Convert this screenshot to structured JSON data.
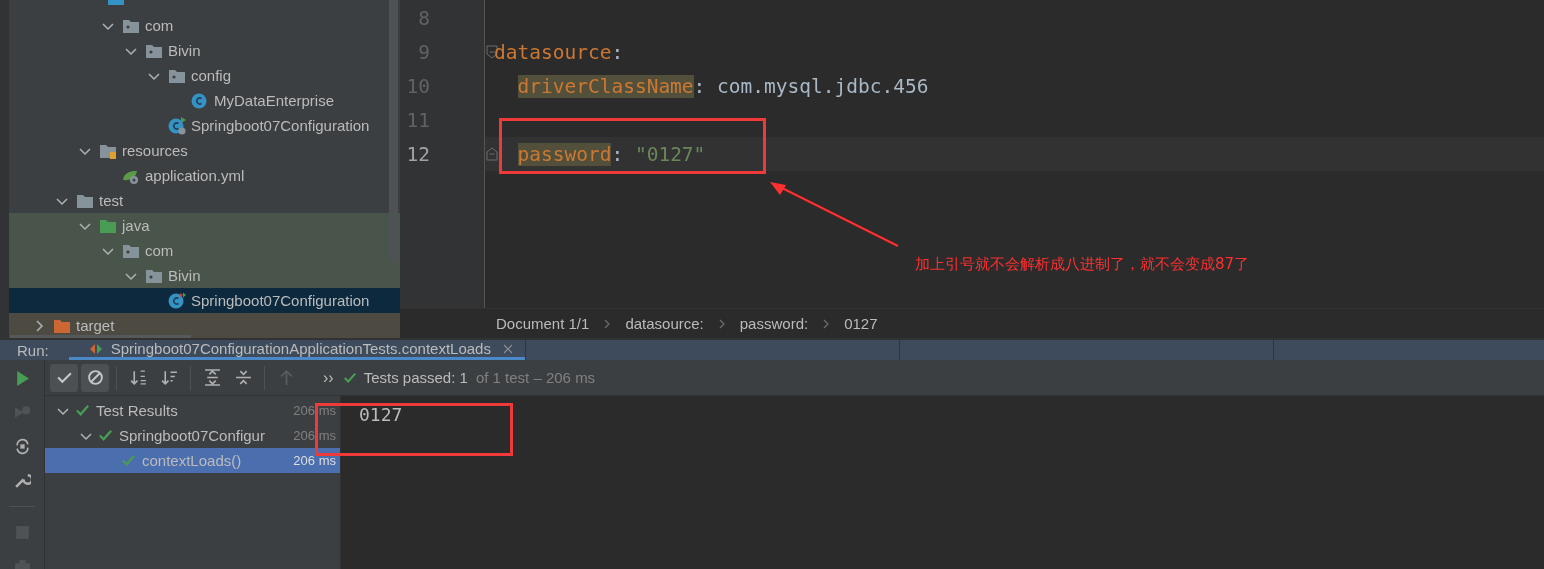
{
  "project_tree": {
    "items": [
      {
        "children": [
          {
            "children": [
              {
                "children": [
                  {
                    "label": "com",
                    "kind": "package",
                    "expanded": true,
                    "selected": false,
                    "test_scope": false,
                    "children": [
                      {
                        "label": "Bivin",
                        "kind": "package",
                        "expanded": true,
                        "selected": false,
                        "test_scope": false,
                        "children": [
                          {
                            "label": "config",
                            "kind": "package",
                            "expanded": true,
                            "selected": false,
                            "test_scope": false,
                            "children": [
                              {
                                "label": "MyDataEnterprise",
                                "kind": "class",
                                "selected": false,
                                "test_scope": false
                              }
                            ]
                          },
                          {
                            "label": "Springboot07Configuration",
                            "kind": "app-class",
                            "selected": false,
                            "test_scope": false
                          }
                        ]
                      }
                    ]
                  }
                ]
              },
              {
                "label": "resources",
                "kind": "resources-folder",
                "expanded": true,
                "selected": false,
                "test_scope": false,
                "children": [
                  {
                    "label": "application.yml",
                    "kind": "yaml",
                    "selected": false,
                    "test_scope": false
                  }
                ]
              }
            ]
          },
          {
            "label": "test",
            "kind": "folder",
            "expanded": true,
            "selected": false,
            "test_scope": false,
            "children": [
              {
                "label": "java",
                "kind": "test-folder",
                "expanded": true,
                "selected": false,
                "test_scope": true,
                "children": [
                  {
                    "label": "com",
                    "kind": "package",
                    "expanded": true,
                    "selected": false,
                    "test_scope": true,
                    "children": [
                      {
                        "label": "Bivin",
                        "kind": "package",
                        "expanded": true,
                        "selected": false,
                        "test_scope": true,
                        "children": [
                          {
                            "label": "Springboot07Configuration",
                            "kind": "test-class",
                            "selected": true
                          }
                        ]
                      }
                    ]
                  }
                ]
              }
            ]
          }
        ]
      },
      {
        "label": "target",
        "kind": "excluded-folder",
        "expanded": false,
        "selected": false
      }
    ]
  },
  "editor": {
    "lines": [
      {
        "number": "8",
        "current": false,
        "fold": false
      },
      {
        "number": "9",
        "current": false,
        "indented": false,
        "fold": true,
        "tokens": [
          {
            "kind": "key",
            "text": "datasource"
          },
          {
            "kind": "plain",
            "text": ":"
          }
        ]
      },
      {
        "number": "10",
        "current": false,
        "indented": true,
        "fold": false,
        "tokens": [
          {
            "kind": "key-marked",
            "text": "driverClassName"
          },
          {
            "kind": "plain",
            "text": ": com.mysql.jdbc.456"
          }
        ]
      },
      {
        "number": "11",
        "current": false,
        "fold": false
      },
      {
        "number": "12",
        "current": true,
        "indented": true,
        "fold": true,
        "tokens": [
          {
            "kind": "key-marked",
            "text": "password"
          },
          {
            "kind": "plain",
            "text": ": "
          },
          {
            "kind": "string",
            "text": "\"0127\""
          }
        ]
      }
    ],
    "breadcrumbs": [
      "Document 1/1",
      "datasource:",
      "password:",
      "0127"
    ]
  },
  "annotation": {
    "note": "加上引号就不会解析成八进制了，就不会变成87了"
  },
  "run_panel": {
    "label": "Run:",
    "tab": {
      "title": "Springboot07ConfigurationApplicationTests.contextLoads",
      "selected": true
    },
    "toolbar": [
      {
        "kind": "show-passed",
        "on": true,
        "disabled": false
      },
      {
        "kind": "show-ignored",
        "on": true,
        "disabled": false
      },
      {
        "kind": "sort-alpha",
        "on": false,
        "disabled": false
      },
      {
        "kind": "sort-duration",
        "on": false,
        "disabled": false
      },
      {
        "kind": "expand-all",
        "on": false,
        "disabled": false
      },
      {
        "kind": "collapse-all",
        "on": false,
        "disabled": false
      },
      {
        "kind": "previous",
        "on": false,
        "disabled": true
      }
    ],
    "more": "››",
    "status": {
      "passed": "Tests passed: 1",
      "detail": "of 1 test – 206 ms"
    },
    "results": [
      {
        "label": "Test Results",
        "time": "206 ms",
        "expanded": true,
        "selected": false,
        "children": [
          {
            "label": "Springboot07Configur",
            "time": "206 ms",
            "expanded": true,
            "selected": false,
            "children": [
              {
                "label": "contextLoads()",
                "time": "206 ms",
                "selected": true
              }
            ]
          }
        ]
      }
    ],
    "console": [
      "0127"
    ]
  }
}
